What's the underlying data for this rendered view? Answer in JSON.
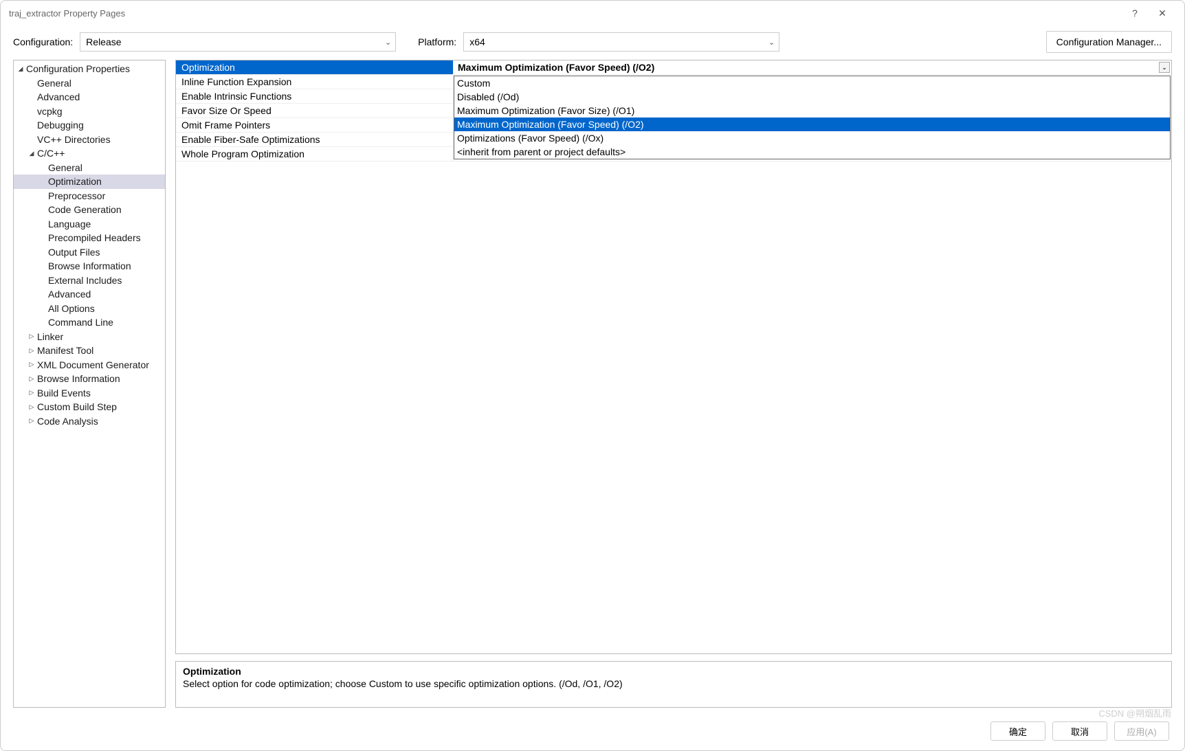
{
  "window": {
    "title": "traj_extractor Property Pages"
  },
  "titlebar": {
    "help": "?",
    "close": "✕"
  },
  "toprow": {
    "config_label": "Configuration:",
    "config_value": "Release",
    "platform_label": "Platform:",
    "platform_value": "x64",
    "manager_button": "Configuration Manager..."
  },
  "tree": [
    {
      "label": "Configuration Properties",
      "indent": 1,
      "tw": "◢"
    },
    {
      "label": "General",
      "indent": 2
    },
    {
      "label": "Advanced",
      "indent": 2
    },
    {
      "label": "vcpkg",
      "indent": 2
    },
    {
      "label": "Debugging",
      "indent": 2
    },
    {
      "label": "VC++ Directories",
      "indent": 2
    },
    {
      "label": "C/C++",
      "indent": 2,
      "tw": "◢"
    },
    {
      "label": "General",
      "indent": 3
    },
    {
      "label": "Optimization",
      "indent": 3,
      "sel": true
    },
    {
      "label": "Preprocessor",
      "indent": 3
    },
    {
      "label": "Code Generation",
      "indent": 3
    },
    {
      "label": "Language",
      "indent": 3
    },
    {
      "label": "Precompiled Headers",
      "indent": 3
    },
    {
      "label": "Output Files",
      "indent": 3
    },
    {
      "label": "Browse Information",
      "indent": 3
    },
    {
      "label": "External Includes",
      "indent": 3
    },
    {
      "label": "Advanced",
      "indent": 3
    },
    {
      "label": "All Options",
      "indent": 3
    },
    {
      "label": "Command Line",
      "indent": 3
    },
    {
      "label": "Linker",
      "indent": 2,
      "tw": "▷"
    },
    {
      "label": "Manifest Tool",
      "indent": 2,
      "tw": "▷"
    },
    {
      "label": "XML Document Generator",
      "indent": 2,
      "tw": "▷"
    },
    {
      "label": "Browse Information",
      "indent": 2,
      "tw": "▷"
    },
    {
      "label": "Build Events",
      "indent": 2,
      "tw": "▷"
    },
    {
      "label": "Custom Build Step",
      "indent": 2,
      "tw": "▷"
    },
    {
      "label": "Code Analysis",
      "indent": 2,
      "tw": "▷"
    }
  ],
  "grid": [
    {
      "name": "Optimization",
      "value": "Maximum Optimization (Favor Speed) (/O2)",
      "sel": true
    },
    {
      "name": "Inline Function Expansion",
      "value": ""
    },
    {
      "name": "Enable Intrinsic Functions",
      "value": ""
    },
    {
      "name": "Favor Size Or Speed",
      "value": ""
    },
    {
      "name": "Omit Frame Pointers",
      "value": ""
    },
    {
      "name": "Enable Fiber-Safe Optimizations",
      "value": ""
    },
    {
      "name": "Whole Program Optimization",
      "value": ""
    }
  ],
  "dropdown": [
    {
      "label": "Custom"
    },
    {
      "label": "Disabled (/Od)"
    },
    {
      "label": "Maximum Optimization (Favor Size) (/O1)"
    },
    {
      "label": "Maximum Optimization (Favor Speed) (/O2)",
      "hl": true
    },
    {
      "label": "Optimizations (Favor Speed) (/Ox)"
    },
    {
      "label": "<inherit from parent or project defaults>"
    }
  ],
  "desc": {
    "title": "Optimization",
    "text": "Select option for code optimization; choose Custom to use specific optimization options.     (/Od, /O1, /O2)"
  },
  "buttons": {
    "ok": "确定",
    "cancel": "取消",
    "apply": "应用(A)"
  },
  "watermark": "CSDN @朔烟乱雨"
}
